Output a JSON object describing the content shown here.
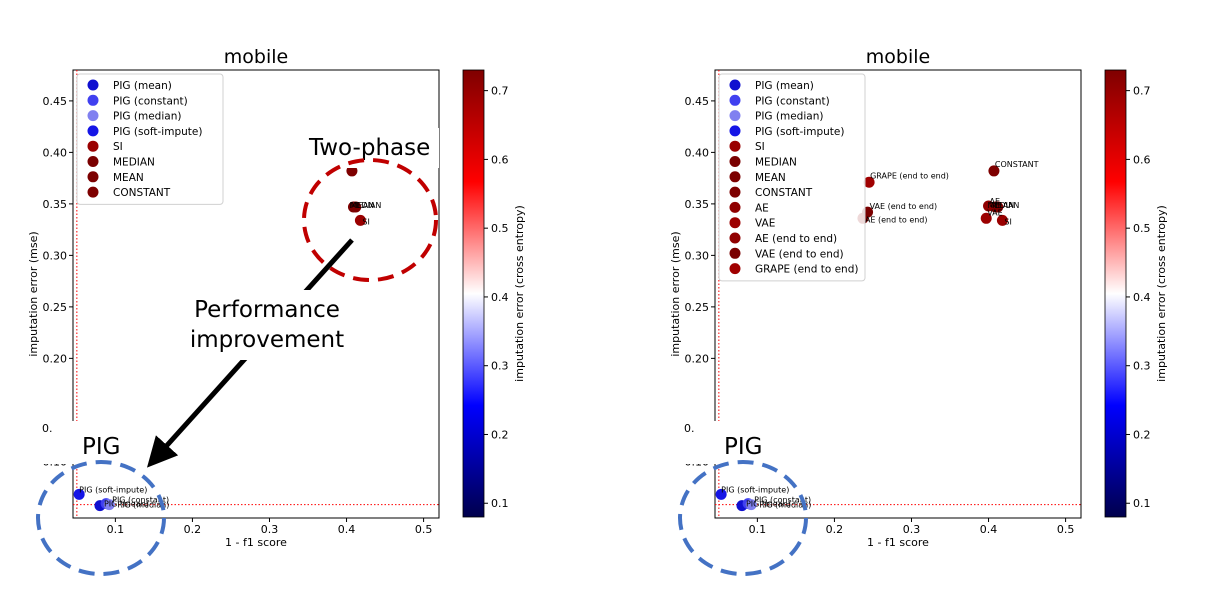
{
  "chart_data": [
    {
      "type": "scatter",
      "title": "mobile",
      "xlabel": "1 - f1 score",
      "ylabel": "imputation error (mse)",
      "colorbar_label": "imputation error (cross entropy)",
      "xlim": [
        0.045,
        0.52
      ],
      "ylim": [
        0.045,
        0.48
      ],
      "x_ticks": [
        0.1,
        0.2,
        0.3,
        0.4,
        0.5
      ],
      "x_tick_labels": [
        "0.1",
        "0.2",
        "0.3",
        "0.4",
        "0.5"
      ],
      "y_ticks": [
        0.1,
        0.2,
        0.25,
        0.3,
        0.35,
        0.4,
        0.45
      ],
      "y_tick_labels": [
        "0.10",
        "0.20",
        "0.25",
        "0.30",
        "0.35",
        "0.40",
        "0.45"
      ],
      "colorbar_ticks": [
        0.1,
        0.2,
        0.3,
        0.4,
        0.5,
        0.6,
        0.7
      ],
      "colorbar_tick_labels": [
        "0.1",
        "0.2",
        "0.3",
        "0.4",
        "0.5",
        "0.6",
        "0.7"
      ],
      "reference_lines": {
        "x": 0.05,
        "y": 0.058
      },
      "legend_position": "upper-left",
      "series": [
        {
          "name": "PIG (mean)",
          "x": 0.08,
          "y": 0.057,
          "color": "#1010d0"
        },
        {
          "name": "PIG (constant)",
          "x": 0.088,
          "y": 0.059,
          "color": "#4040f0"
        },
        {
          "name": "PIG (median)",
          "x": 0.092,
          "y": 0.058,
          "color": "#8080f0"
        },
        {
          "name": "PIG (soft-impute)",
          "x": 0.053,
          "y": 0.068,
          "color": "#1515e6"
        },
        {
          "name": "SI",
          "x": 0.418,
          "y": 0.334,
          "color": "#9a0000"
        },
        {
          "name": "MEDIAN",
          "x": 0.409,
          "y": 0.347,
          "color": "#7a0000"
        },
        {
          "name": "MEAN",
          "x": 0.412,
          "y": 0.347,
          "color": "#7c0000"
        },
        {
          "name": "CONSTANT",
          "x": 0.407,
          "y": 0.382,
          "color": "#7e0000"
        }
      ],
      "point_labels": [
        {
          "text": "PIG (soft-impute)",
          "series": "PIG (soft-impute)"
        },
        {
          "text": "PIG (mean)",
          "series": "PIG (mean)"
        },
        {
          "text": "PIG (constant)",
          "series": "PIG (constant)"
        },
        {
          "text": "PIG (median)",
          "series": "PIG (median)"
        },
        {
          "text": "CONSTANT",
          "series": "CONSTANT"
        },
        {
          "text": "MEDIAN",
          "series": "MEDIAN"
        },
        {
          "text": "MEAN",
          "series": "MEAN"
        },
        {
          "text": "SI",
          "series": "SI"
        }
      ],
      "annotations": {
        "two_phase": "Two-phase",
        "improvement_line1": "Performance",
        "improvement_line2": "improvement",
        "pig": "PIG",
        "partial_tick": "0."
      }
    },
    {
      "type": "scatter",
      "title": "mobile",
      "xlabel": "1 - f1 score",
      "ylabel": "imputation error (mse)",
      "colorbar_label": "imputation error (cross entropy)",
      "xlim": [
        0.045,
        0.52
      ],
      "ylim": [
        0.045,
        0.48
      ],
      "x_ticks": [
        0.1,
        0.2,
        0.3,
        0.4,
        0.5
      ],
      "x_tick_labels": [
        "0.1",
        "0.2",
        "0.3",
        "0.4",
        "0.5"
      ],
      "y_ticks": [
        0.1,
        0.2,
        0.25,
        0.3,
        0.35,
        0.4,
        0.45
      ],
      "y_tick_labels": [
        "0.10",
        "0.20",
        "0.25",
        "0.30",
        "0.35",
        "0.40",
        "0.45"
      ],
      "colorbar_ticks": [
        0.1,
        0.2,
        0.3,
        0.4,
        0.5,
        0.6,
        0.7
      ],
      "colorbar_tick_labels": [
        "0.1",
        "0.2",
        "0.3",
        "0.4",
        "0.5",
        "0.6",
        "0.7"
      ],
      "reference_lines": {
        "x": 0.05,
        "y": 0.058
      },
      "legend_position": "upper-left",
      "series": [
        {
          "name": "PIG (mean)",
          "x": 0.08,
          "y": 0.057,
          "color": "#1010d0"
        },
        {
          "name": "PIG (constant)",
          "x": 0.088,
          "y": 0.059,
          "color": "#4040f0"
        },
        {
          "name": "PIG (median)",
          "x": 0.092,
          "y": 0.058,
          "color": "#8080f0"
        },
        {
          "name": "PIG (soft-impute)",
          "x": 0.053,
          "y": 0.068,
          "color": "#1515e6"
        },
        {
          "name": "SI",
          "x": 0.418,
          "y": 0.334,
          "color": "#9a0000"
        },
        {
          "name": "MEDIAN",
          "x": 0.409,
          "y": 0.347,
          "color": "#7a0000"
        },
        {
          "name": "MEAN",
          "x": 0.412,
          "y": 0.347,
          "color": "#7c0000"
        },
        {
          "name": "CONSTANT",
          "x": 0.407,
          "y": 0.382,
          "color": "#7e0000"
        },
        {
          "name": "AE",
          "x": 0.4,
          "y": 0.348,
          "color": "#900000"
        },
        {
          "name": "VAE",
          "x": 0.397,
          "y": 0.336,
          "color": "#9c0000"
        },
        {
          "name": "AE (end to end)",
          "x": 0.237,
          "y": 0.336,
          "color": "#900000"
        },
        {
          "name": "VAE (end to end)",
          "x": 0.243,
          "y": 0.342,
          "color": "#7a0000"
        },
        {
          "name": "GRAPE (end to end)",
          "x": 0.245,
          "y": 0.371,
          "color": "#a00000"
        }
      ],
      "point_labels": [
        {
          "text": "PIG (soft-impute)",
          "series": "PIG (soft-impute)"
        },
        {
          "text": "PIG (mean)",
          "series": "PIG (mean)"
        },
        {
          "text": "PIG (constant)",
          "series": "PIG (constant)"
        },
        {
          "text": "PIG (median)",
          "series": "PIG (median)"
        },
        {
          "text": "CONSTANT",
          "series": "CONSTANT"
        },
        {
          "text": "GRAPE (end to end)",
          "series": "GRAPE (end to end)"
        },
        {
          "text": "VAE (end to end)",
          "series": "VAE (end to end)"
        },
        {
          "text": "AE (end to end)",
          "series": "AE (end to end)"
        },
        {
          "text": "AE",
          "series": "AE"
        },
        {
          "text": "MEDIAN",
          "series": "MEDIAN"
        },
        {
          "text": "MEAN",
          "series": "MEAN"
        },
        {
          "text": "VAE",
          "series": "VAE"
        },
        {
          "text": "SI",
          "series": "SI"
        }
      ],
      "annotations": {
        "pig": "PIG",
        "partial_tick": "0."
      }
    }
  ]
}
